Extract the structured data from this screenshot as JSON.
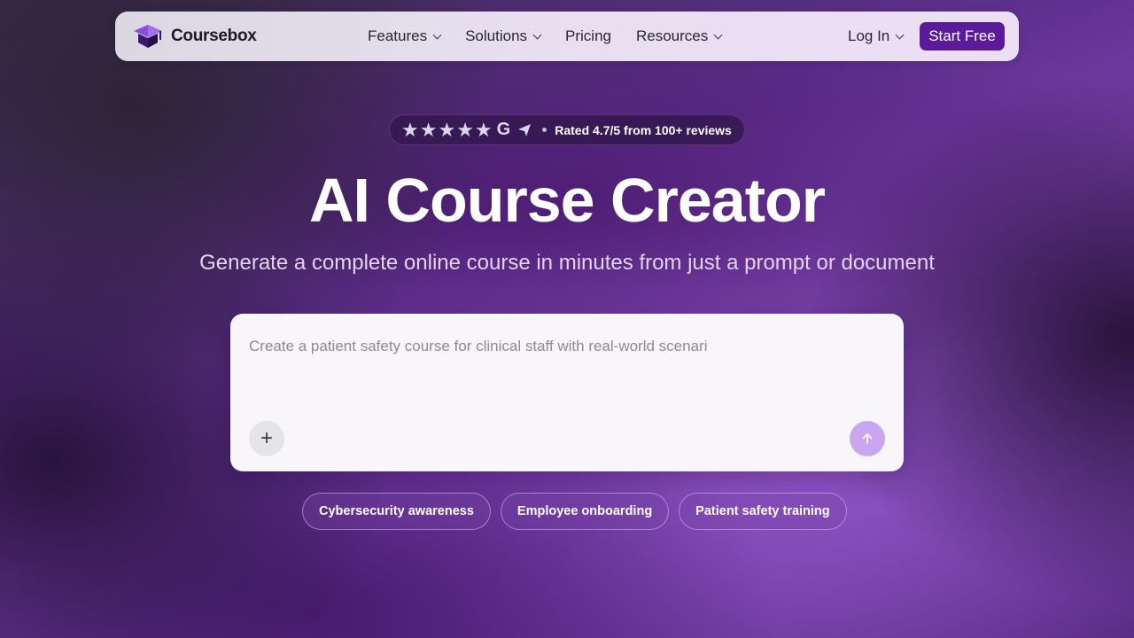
{
  "nav": {
    "brand": "Coursebox",
    "menu": [
      {
        "label": "Features",
        "dropdown": true
      },
      {
        "label": "Solutions",
        "dropdown": true
      },
      {
        "label": "Pricing",
        "dropdown": false
      },
      {
        "label": "Resources",
        "dropdown": true
      }
    ],
    "login_label": "Log In",
    "start_label": "Start Free"
  },
  "rating": {
    "stars": 5,
    "text": "Rated 4.7/5 from 100+ reviews"
  },
  "hero": {
    "title": "AI Course Creator",
    "subtitle": "Generate a complete online course in minutes from just a prompt or document"
  },
  "prompt": {
    "placeholder": "Create a patient safety course for clinical staff with real-world scenari",
    "add_icon": "plus-icon",
    "send_icon": "arrow-up-icon"
  },
  "chips": [
    "Cybersecurity awareness",
    "Employee onboarding",
    "Patient safety training"
  ],
  "colors": {
    "accent": "#5a1a99",
    "send_button": "#c9a6ef",
    "background": "#6c34a0"
  }
}
